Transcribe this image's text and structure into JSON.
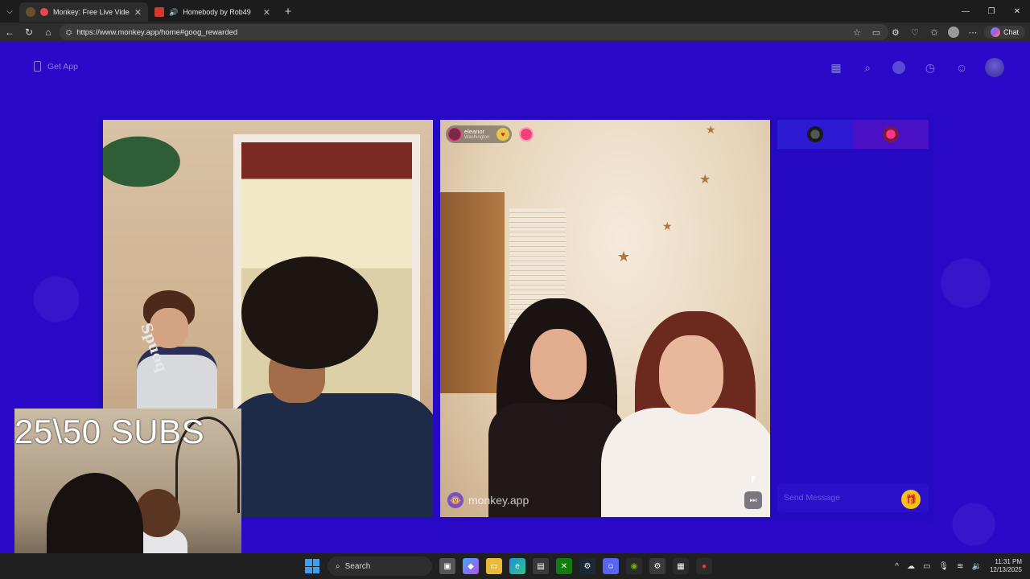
{
  "browser": {
    "tabs": [
      {
        "title": "Monkey: Free Live Video Chat",
        "active": true
      },
      {
        "title": "Homebody by Rob49",
        "active": false
      }
    ],
    "url": "https://www.monkey.app/home#goog_rewarded",
    "copilot_label": "Chat"
  },
  "page": {
    "get_app_label": "Get App",
    "peer": {
      "name": "eleanor",
      "location": "Washington"
    },
    "watermark": "monkey.app",
    "chat_placeholder": "Send Message"
  },
  "overlay": {
    "subs_text": "25\\50 SUBS",
    "hoodie_text": "Spuoq"
  },
  "taskbar": {
    "search_label": "Search",
    "time": "11:31 PM",
    "date": "12/13/2025"
  },
  "colors": {
    "page_bg": "#2a09c9",
    "accent_yellow": "#f3c414"
  }
}
